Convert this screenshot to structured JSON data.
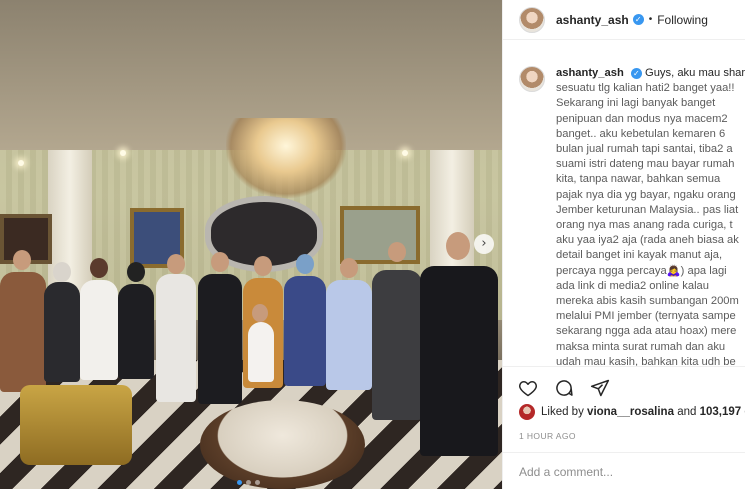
{
  "post": {
    "username": "ashanty_ash",
    "follow_status": "Following",
    "separator": "•",
    "caption_lines": [
      "Guys, aku mau share",
      "sesuatu tlg kalian hati2 banget yaa!!",
      "Sekarang ini lagi banyak banget",
      "penipuan dan modus nya macem2",
      "banget.. aku kebetulan kemaren 6",
      "bulan jual rumah tapi santai, tiba2 a",
      "suami istri dateng mau bayar rumah",
      "kita, tanpa nawar, bahkan semua",
      "pajak nya dia yg bayar, ngaku orang",
      "Jember keturunan Malaysia.. pas liat",
      "orang nya mas anang rada curiga, t",
      "aku yaa iya2 aja (rada aneh biasa ak",
      "detail banget ini kayak manut aja,",
      "percaya ngga percaya🙇‍♀️) apa lagi",
      "ada link di media2 online kalau",
      "mereka abis kasih sumbangan 200m",
      "melalui PMI jember (ternyata sampe",
      "sekarang ngga ada atau hoax) mere",
      "maksa minta surat rumah dan aku",
      "udah mau kasih, bahkan kita udh be"
    ],
    "likes": {
      "prefix": "Liked by",
      "user": "viona__rosalina",
      "connector": "and",
      "count": "103,197",
      "suffix": "o"
    },
    "timestamp": "1 HOUR AGO",
    "comment_placeholder": "Add a comment...",
    "carousel_next": "›",
    "carousel_position": 1,
    "carousel_total": 3
  },
  "icons": {
    "verified": "verified-badge-icon",
    "like": "heart-icon",
    "comment": "comment-bubble-icon",
    "share": "paper-plane-icon",
    "next": "chevron-right-icon"
  },
  "colors": {
    "accent": "#3897f0",
    "text": "#262626",
    "muted": "#8e8e8e",
    "border": "#efefef"
  }
}
